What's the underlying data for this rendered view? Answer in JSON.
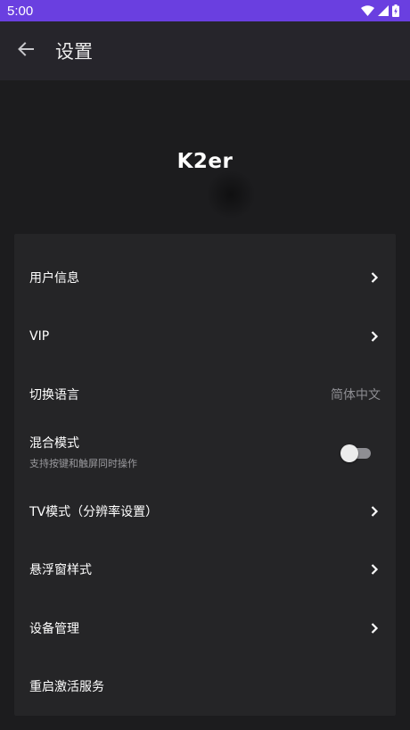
{
  "status_bar": {
    "time": "5:00",
    "icons": [
      "wifi-icon",
      "signal-icon",
      "battery-charging-icon"
    ],
    "color": "#6a3fe0"
  },
  "app_bar": {
    "back_icon": "arrow-left-icon",
    "title": "设置"
  },
  "logo": {
    "text": "K2er"
  },
  "settings": {
    "user_info": {
      "label": "用户信息",
      "trailing": "chevron-right-icon"
    },
    "vip": {
      "label": "VIP",
      "trailing": "chevron-right-icon"
    },
    "language": {
      "label": "切换语言",
      "value": "简体中文"
    },
    "mixed_mode": {
      "label": "混合模式",
      "subtitle": "支持按键和触屏同时操作",
      "enabled": false
    },
    "tv_mode": {
      "label": "TV模式（分辨率设置）",
      "trailing": "chevron-right-icon"
    },
    "float_window": {
      "label": "悬浮窗样式",
      "trailing": "chevron-right-icon"
    },
    "device_mgmt": {
      "label": "设备管理",
      "trailing": "chevron-right-icon"
    },
    "restart_service": {
      "label": "重启激活服务"
    }
  }
}
